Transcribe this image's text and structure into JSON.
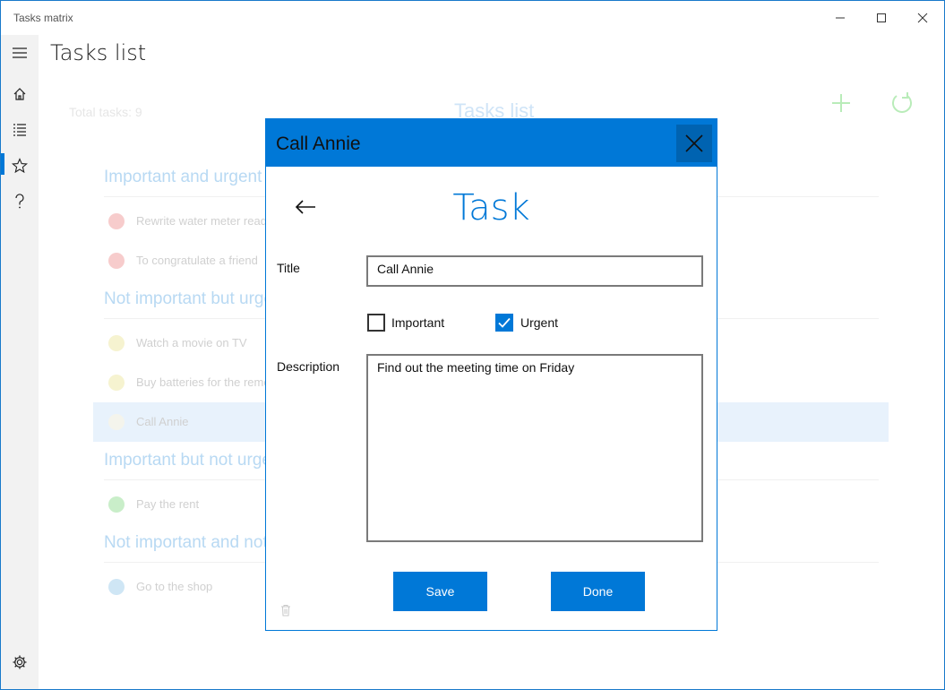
{
  "window": {
    "title": "Tasks matrix"
  },
  "page": {
    "title": "Tasks list"
  },
  "list": {
    "total_label": "Total tasks:",
    "total_count": "9",
    "title": "Tasks list",
    "groups": [
      {
        "header": "Important and urgent",
        "tasks": [
          "Rewrite water meter readings",
          "To congratulate a friend"
        ]
      },
      {
        "header": "Not important but urgent",
        "tasks": [
          "Watch a movie on TV",
          "Buy batteries for the remote",
          "Call Annie"
        ]
      },
      {
        "header": "Important but not urgent",
        "tasks": [
          "Pay the rent"
        ]
      },
      {
        "header": "Not important and not urgent",
        "tasks": [
          "Go to the shop"
        ]
      }
    ]
  },
  "dialog": {
    "title": "Call Annie",
    "heading": "Task",
    "title_label": "Title",
    "title_value": "Call Annie",
    "important_label": "Important",
    "important_checked": false,
    "urgent_label": "Urgent",
    "urgent_checked": true,
    "description_label": "Description",
    "description_value": "Find out the meeting time on Friday",
    "save_label": "Save",
    "done_label": "Done"
  },
  "colors": {
    "accent": "#0078d7",
    "important_urgent": "#f2b8b8",
    "not_important_urgent": "#f4efb8",
    "important_not_urgent": "#b8e6b8",
    "not_important_not_urgent": "#b8dcf2"
  },
  "icons": {
    "nav": [
      "hamburger-icon",
      "home-icon",
      "list-icon",
      "star-icon",
      "help-icon",
      "settings-icon"
    ],
    "actions": [
      "add-icon",
      "refresh-icon",
      "back-arrow-icon",
      "close-icon",
      "trash-icon"
    ]
  }
}
